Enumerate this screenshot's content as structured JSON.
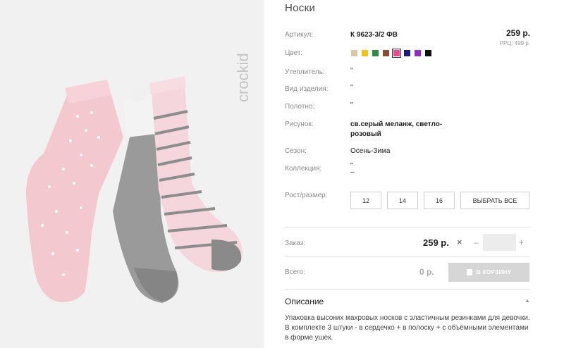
{
  "product": {
    "title": "Носки",
    "brand_watermark": "crockid",
    "price": "259 р.",
    "rrp": "РРЦ: 499 р."
  },
  "attributes": [
    {
      "label": "Артикул:",
      "value": "К 9623-3/2 ФВ"
    },
    {
      "label": "Цвет:"
    },
    {
      "label": "Утеплитель:",
      "value": "\""
    },
    {
      "label": "Вид изделия:",
      "value": "\""
    },
    {
      "label": "Полотно:",
      "value": "\""
    },
    {
      "label": "Рисунок:",
      "value": "св.серый меланж, светло-розовый"
    },
    {
      "label": "Сезон:",
      "value": "Осень-Зима"
    },
    {
      "label": "Коллекция:",
      "value": "\"\n–"
    }
  ],
  "colors": [
    "#d8c8a8",
    "#f0c419",
    "#2e8b4a",
    "#8b4a32",
    "#e84b8a",
    "#1b1b7a",
    "#8e2fbf",
    "#111111"
  ],
  "selected_color_index": 4,
  "sizes": {
    "label": "Рост/размер:",
    "options": [
      "12",
      "14",
      "16"
    ],
    "select_all": "ВЫБРАТЬ ВСЕ"
  },
  "order": {
    "label": "Заказ:",
    "price": "259 р.",
    "times": "×",
    "minus": "–",
    "plus": "+",
    "quantity": ""
  },
  "total": {
    "label": "Всего:",
    "price": "0 р.",
    "cart_button": "В КОРЗИНУ"
  },
  "description": {
    "title": "Описание",
    "caret": "▲",
    "text": "Упаковка высоких махровых носков с эластичным резинками для девочки. В комплекте 3 штуки - в сердечко + в полоску + с объёмными элементами в форме ушек."
  }
}
